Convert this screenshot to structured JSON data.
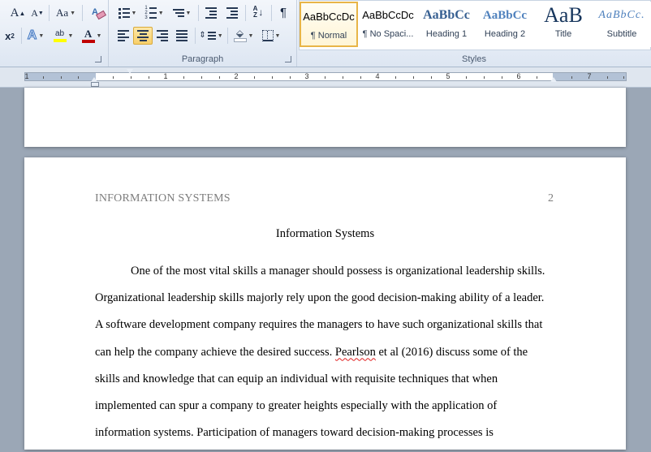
{
  "ribbon": {
    "font": {
      "grow_label": "A",
      "shrink_label": "A",
      "change_case_label": "Aa",
      "clear_format_label": "A",
      "subscript_label": "x",
      "text_effects_label": "A",
      "highlight_label": "ab",
      "font_color_label": "A",
      "font_color": "#c00000",
      "highlight_color": "#ffff00"
    },
    "paragraph": {
      "label": "Paragraph",
      "pilcrow": "¶"
    },
    "styles": {
      "label": "Styles",
      "items": [
        {
          "preview": "AaBbCcDc",
          "name": "¶ Normal"
        },
        {
          "preview": "AaBbCcDc",
          "name": "¶ No Spaci..."
        },
        {
          "preview": "AaBbCc",
          "name": "Heading 1"
        },
        {
          "preview": "AaBbCc",
          "name": "Heading 2"
        },
        {
          "preview": "AaB",
          "name": "Title"
        },
        {
          "preview": "AaBbCc.",
          "name": "Subtitle"
        }
      ]
    }
  },
  "ruler": {
    "numbers": [
      "1",
      "1",
      "2",
      "3",
      "4",
      "5",
      "6",
      "7"
    ]
  },
  "document": {
    "header": "INFORMATION SYSTEMS",
    "page_number": "2",
    "title": "Information Systems",
    "lines": [
      "One of the most vital skills a manager should possess is organizational leadership skills.",
      "Organizational leadership skills majorly rely upon the good decision-making ability of a leader.",
      "A software development company requires the managers to have such organizational skills that",
      "can help the company achieve the desired success.",
      "Pearlson",
      " et al (2016) discuss some of the",
      "skills and knowledge that can equip an individual with requisite techniques that when",
      "implemented can spur a company to greater heights especially with the application of",
      "information systems. Participation of managers toward decision-making processes is"
    ]
  }
}
